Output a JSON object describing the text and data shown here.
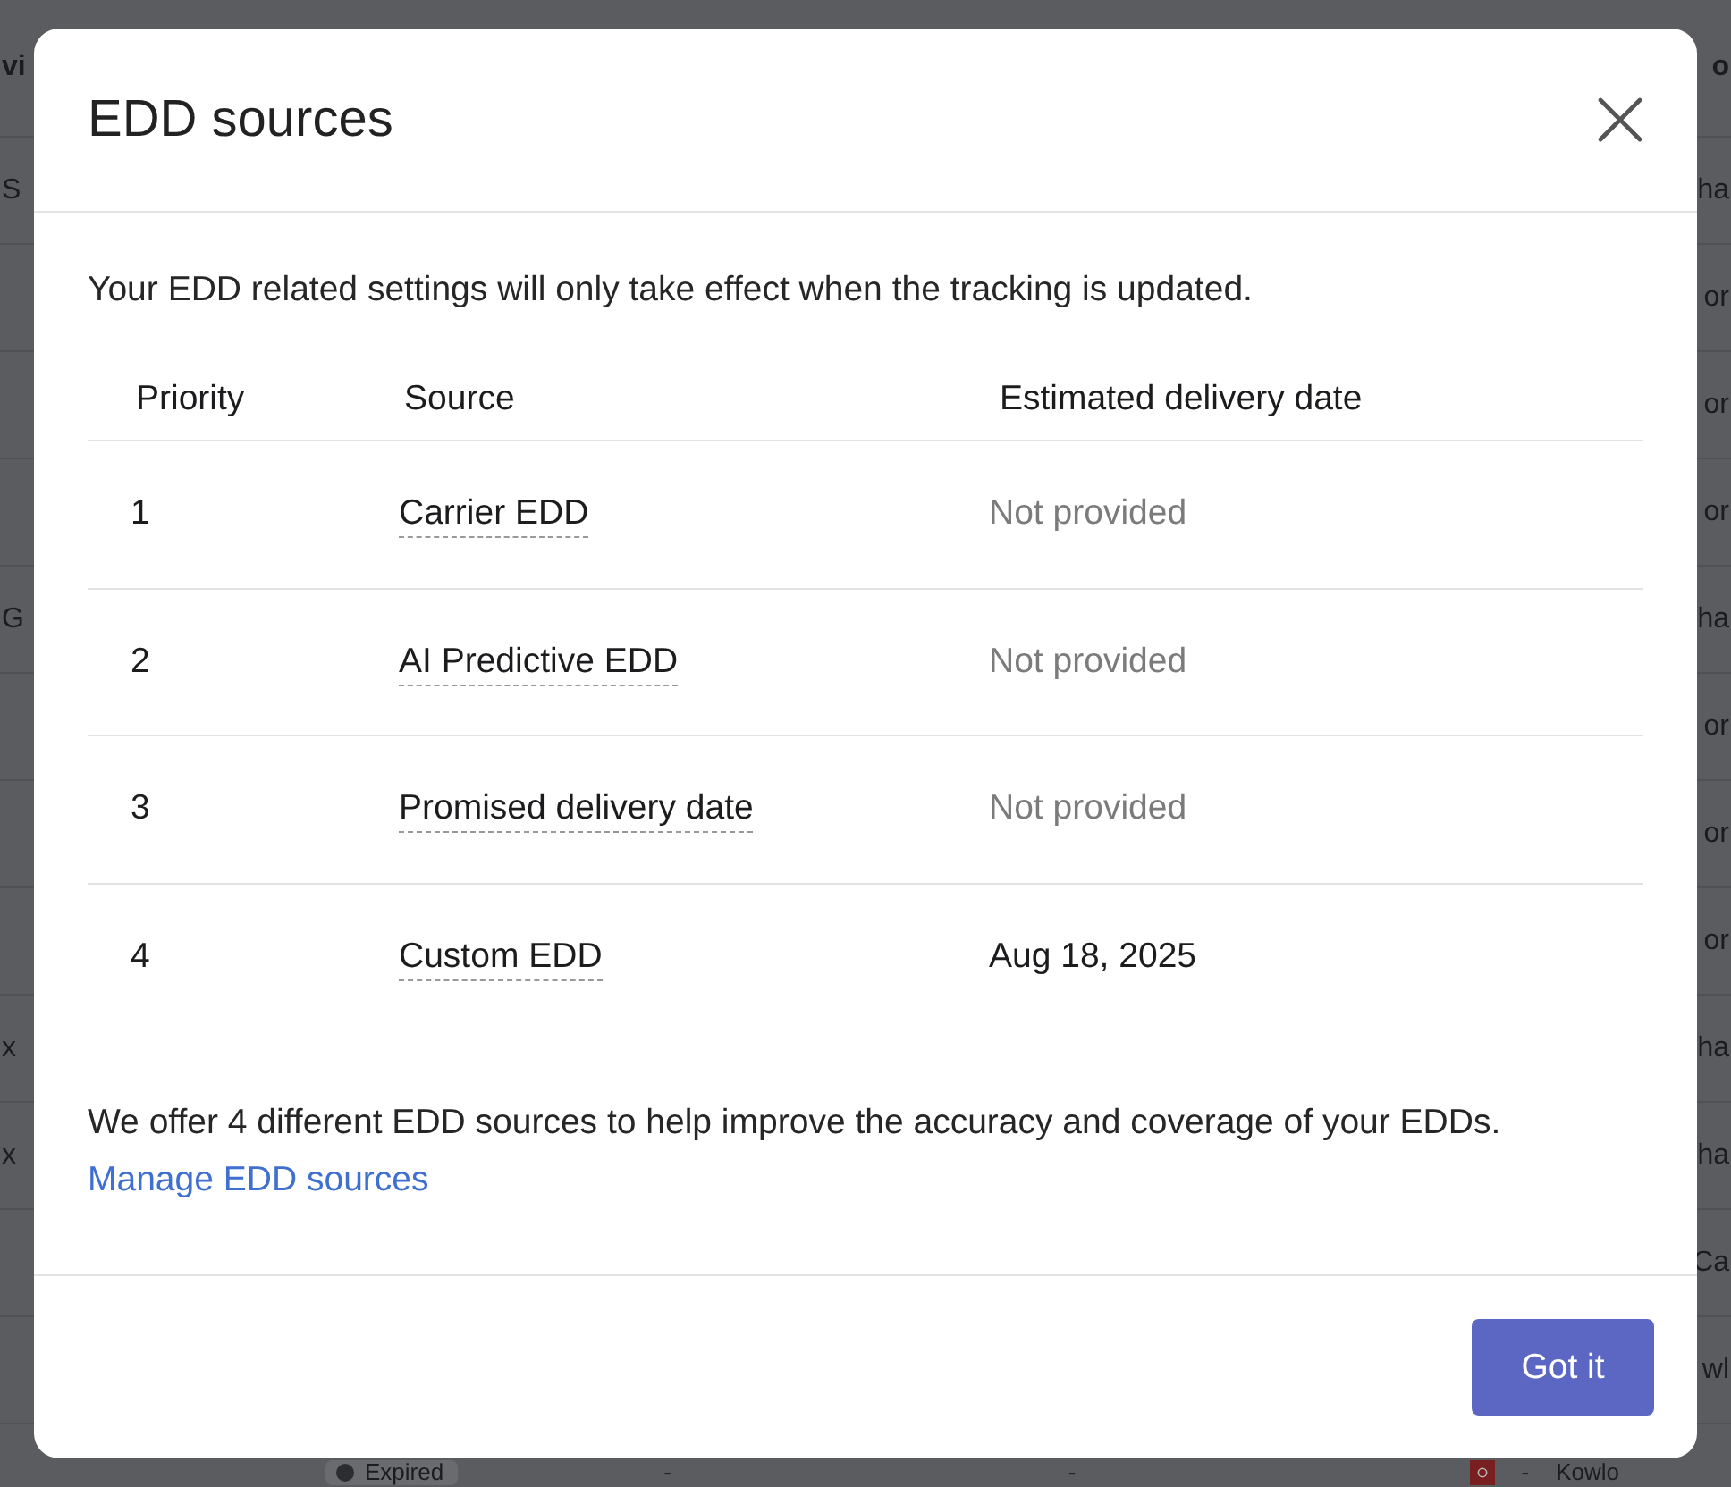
{
  "background": {
    "header": {
      "left": "vi",
      "right": "o"
    },
    "rows": [
      {
        "left": "S",
        "right": "ha"
      },
      {
        "right": "or"
      },
      {
        "right": "or"
      },
      {
        "right": "or"
      },
      {
        "left": "G",
        "right": "ha"
      },
      {
        "right": "or"
      },
      {
        "right": "or"
      },
      {
        "right": "or"
      },
      {
        "left": "x",
        "right": "ha"
      },
      {
        "left": "x",
        "right": "ha"
      },
      {
        "right": "Ca"
      },
      {
        "right": "wl"
      }
    ],
    "last_row": {
      "status": "Expired",
      "column_2": "-",
      "column_3": "-",
      "column_4": "-",
      "column_5": "Kowlo"
    }
  },
  "dialog": {
    "title": "EDD sources",
    "intro": "Your EDD related settings will only take effect when the tracking is updated.",
    "columns": [
      "Priority",
      "Source",
      "Estimated delivery date"
    ],
    "rows": [
      {
        "priority": "1",
        "source": "Carrier EDD",
        "date": "Not provided",
        "muted": true
      },
      {
        "priority": "2",
        "source": "AI Predictive EDD",
        "date": "Not provided",
        "muted": true
      },
      {
        "priority": "3",
        "source": "Promised delivery date",
        "date": "Not provided",
        "muted": true
      },
      {
        "priority": "4",
        "source": "Custom EDD",
        "date": "Aug 18, 2025",
        "muted": false
      }
    ],
    "footer_text": "We offer 4 different EDD sources to help improve the accuracy and coverage of your EDDs.",
    "footer_link": "Manage EDD sources",
    "button": "Got it"
  }
}
